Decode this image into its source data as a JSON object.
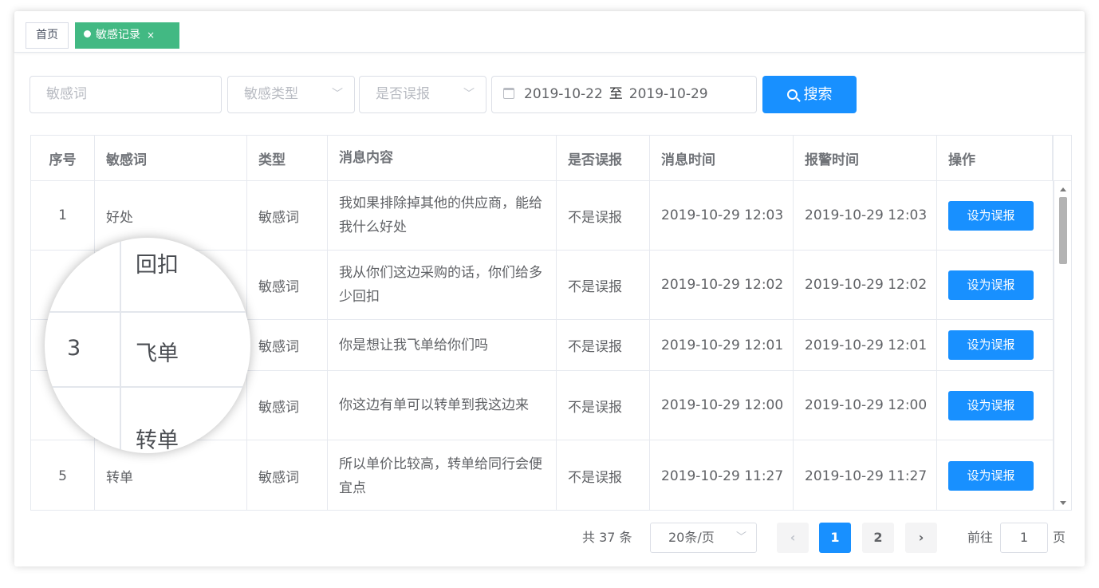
{
  "tabs": {
    "home": "首页",
    "active": "敏感记录",
    "active_close": "×"
  },
  "filters": {
    "word_placeholder": "敏感词",
    "type_placeholder": "敏感类型",
    "false_placeholder": "是否误报",
    "date_start": "2019-10-22",
    "date_sep": "至",
    "date_end": "2019-10-29",
    "search_label": "搜索"
  },
  "table": {
    "headers": {
      "no": "序号",
      "word": "敏感词",
      "type": "类型",
      "msg": "消息内容",
      "false": "是否误报",
      "msg_time": "消息时间",
      "alarm_time": "报警时间",
      "op": "操作"
    },
    "rows": [
      {
        "no": "1",
        "word": "好处",
        "type": "敏感词",
        "msg": "我如果排除掉其他的供应商，能给我什么好处",
        "false": "不是误报",
        "msg_time": "2019-10-29 12:03",
        "alarm_time": "2019-10-29 12:03",
        "op": "设为误报"
      },
      {
        "no": "",
        "word": "",
        "type": "敏感词",
        "msg": "我从你们这边采购的话，你们给多少回扣",
        "false": "不是误报",
        "msg_time": "2019-10-29 12:02",
        "alarm_time": "2019-10-29 12:02",
        "op": "设为误报"
      },
      {
        "no": "",
        "word": "",
        "type": "敏感词",
        "msg": "你是想让我飞单给你们吗",
        "false": "不是误报",
        "msg_time": "2019-10-29 12:01",
        "alarm_time": "2019-10-29 12:01",
        "op": "设为误报"
      },
      {
        "no": "",
        "word": "",
        "type": "敏感词",
        "msg": "你这边有单可以转单到我这边来",
        "false": "不是误报",
        "msg_time": "2019-10-29 12:00",
        "alarm_time": "2019-10-29 12:00",
        "op": "设为误报"
      },
      {
        "no": "5",
        "word": "转单",
        "type": "敏感词",
        "msg": "所以单价比较高，转单给同行会便宜点",
        "false": "不是误报",
        "msg_time": "2019-10-29 11:27",
        "alarm_time": "2019-10-29 11:27",
        "op": "设为误报"
      }
    ]
  },
  "magnifier": {
    "word_top": "回扣",
    "no_mid": "3",
    "word_mid": "飞单",
    "word_bottom": "转单"
  },
  "pagination": {
    "total": "共 37 条",
    "page_size": "20条/页",
    "prev": "‹",
    "page1": "1",
    "page2": "2",
    "next": "›",
    "goto_label": "前往",
    "goto_value": "1",
    "goto_unit": "页"
  }
}
